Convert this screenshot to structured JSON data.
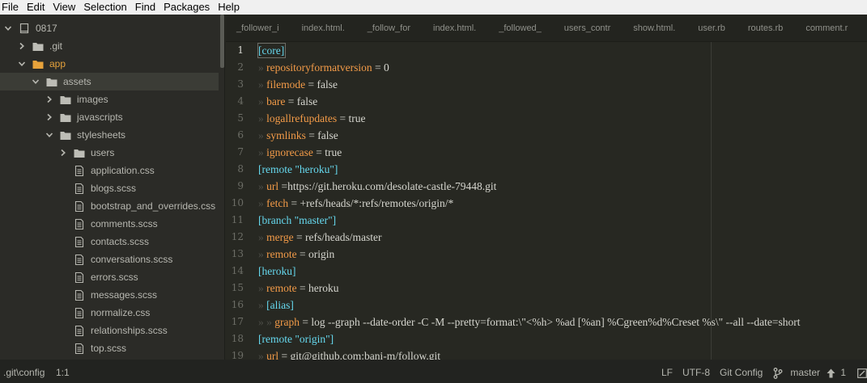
{
  "menu": [
    "File",
    "Edit",
    "View",
    "Selection",
    "Find",
    "Packages",
    "Help"
  ],
  "tree": [
    {
      "label": "0817",
      "depth": 0,
      "type": "project",
      "open": true
    },
    {
      "label": ".git",
      "depth": 1,
      "type": "folder",
      "open": false
    },
    {
      "label": "app",
      "depth": 1,
      "type": "folder",
      "open": true,
      "accent": true
    },
    {
      "label": "assets",
      "depth": 2,
      "type": "folder",
      "open": true,
      "selected": true
    },
    {
      "label": "images",
      "depth": 3,
      "type": "folder",
      "open": false
    },
    {
      "label": "javascripts",
      "depth": 3,
      "type": "folder",
      "open": false
    },
    {
      "label": "stylesheets",
      "depth": 3,
      "type": "folder",
      "open": true
    },
    {
      "label": "users",
      "depth": 4,
      "type": "folder",
      "open": false
    },
    {
      "label": "application.css",
      "depth": 4,
      "type": "file"
    },
    {
      "label": "blogs.scss",
      "depth": 4,
      "type": "file"
    },
    {
      "label": "bootstrap_and_overrides.css",
      "depth": 4,
      "type": "file"
    },
    {
      "label": "comments.scss",
      "depth": 4,
      "type": "file"
    },
    {
      "label": "contacts.scss",
      "depth": 4,
      "type": "file"
    },
    {
      "label": "conversations.scss",
      "depth": 4,
      "type": "file"
    },
    {
      "label": "errors.scss",
      "depth": 4,
      "type": "file"
    },
    {
      "label": "messages.scss",
      "depth": 4,
      "type": "file"
    },
    {
      "label": "normalize.css",
      "depth": 4,
      "type": "file"
    },
    {
      "label": "relationships.scss",
      "depth": 4,
      "type": "file"
    },
    {
      "label": "top.scss",
      "depth": 4,
      "type": "file"
    }
  ],
  "tabs": [
    "_follower_i",
    "index.html.",
    "_follow_for",
    "index.html.",
    "_followed_",
    "users_contr",
    "show.html.",
    "user.rb",
    "routes.rb",
    "comment.r"
  ],
  "lines": [
    {
      "n": "1",
      "parts": [
        [
          "sec",
          "[core]"
        ]
      ],
      "active": true
    },
    {
      "n": "2",
      "parts": [
        [
          "ind",
          "» "
        ],
        [
          "key",
          "repositoryformatversion"
        ],
        [
          "txt",
          " = 0"
        ]
      ]
    },
    {
      "n": "3",
      "parts": [
        [
          "ind",
          "» "
        ],
        [
          "key",
          "filemode"
        ],
        [
          "txt",
          " = false"
        ]
      ]
    },
    {
      "n": "4",
      "parts": [
        [
          "ind",
          "» "
        ],
        [
          "key",
          "bare"
        ],
        [
          "txt",
          " = false"
        ]
      ]
    },
    {
      "n": "5",
      "parts": [
        [
          "ind",
          "» "
        ],
        [
          "key",
          "logallrefupdates"
        ],
        [
          "txt",
          " = true"
        ]
      ]
    },
    {
      "n": "6",
      "parts": [
        [
          "ind",
          "» "
        ],
        [
          "key",
          "symlinks"
        ],
        [
          "txt",
          " = false"
        ]
      ]
    },
    {
      "n": "7",
      "parts": [
        [
          "ind",
          "» "
        ],
        [
          "key",
          "ignorecase"
        ],
        [
          "txt",
          " = true"
        ]
      ]
    },
    {
      "n": "8",
      "parts": [
        [
          "sec",
          "[remote \"heroku\"]"
        ]
      ]
    },
    {
      "n": "9",
      "parts": [
        [
          "ind",
          "» "
        ],
        [
          "key",
          "url"
        ],
        [
          "txt",
          " =https://git.heroku.com/desolate-castle-79448.git"
        ]
      ]
    },
    {
      "n": "10",
      "parts": [
        [
          "ind",
          "» "
        ],
        [
          "key",
          "fetch"
        ],
        [
          "txt",
          " = +refs/heads/*:refs/remotes/origin/*"
        ]
      ]
    },
    {
      "n": "11",
      "parts": [
        [
          "sec",
          "[branch \"master\"]"
        ]
      ]
    },
    {
      "n": "12",
      "parts": [
        [
          "ind",
          "» "
        ],
        [
          "key",
          "merge"
        ],
        [
          "txt",
          " = refs/heads/master"
        ]
      ]
    },
    {
      "n": "13",
      "parts": [
        [
          "ind",
          "» "
        ],
        [
          "key",
          "remote"
        ],
        [
          "txt",
          " = origin"
        ]
      ]
    },
    {
      "n": "14",
      "parts": [
        [
          "sec",
          "[heroku]"
        ]
      ]
    },
    {
      "n": "15",
      "parts": [
        [
          "ind",
          "» "
        ],
        [
          "key",
          "remote"
        ],
        [
          "txt",
          " = heroku"
        ]
      ]
    },
    {
      "n": "16",
      "parts": [
        [
          "ind",
          "» "
        ],
        [
          "sec",
          "[alias]"
        ]
      ]
    },
    {
      "n": "17",
      "parts": [
        [
          "ind",
          "» » "
        ],
        [
          "key",
          "graph"
        ],
        [
          "txt",
          " = log --graph --date-order -C -M --pretty=format:\\\"<%h> %ad [%an] %Cgreen%d%Creset %s\\\" --all --date=short"
        ]
      ]
    },
    {
      "n": "18",
      "parts": [
        [
          "sec",
          "[remote \"origin\"]"
        ]
      ]
    },
    {
      "n": "19",
      "parts": [
        [
          "ind",
          "» "
        ],
        [
          "key",
          "url"
        ],
        [
          "txt",
          " = git@github.com:bani-m/follow.git"
        ]
      ]
    }
  ],
  "status": {
    "file": ".git\\config",
    "cursor": "1:1",
    "eol": "LF",
    "encoding": "UTF-8",
    "grammar": "Git Config",
    "branch": "master",
    "push_count": "1"
  },
  "colors": {
    "folder": "#bdbdb6",
    "accent": "#e6a23b",
    "section": "#66d9ef",
    "key": "#f39b48"
  }
}
